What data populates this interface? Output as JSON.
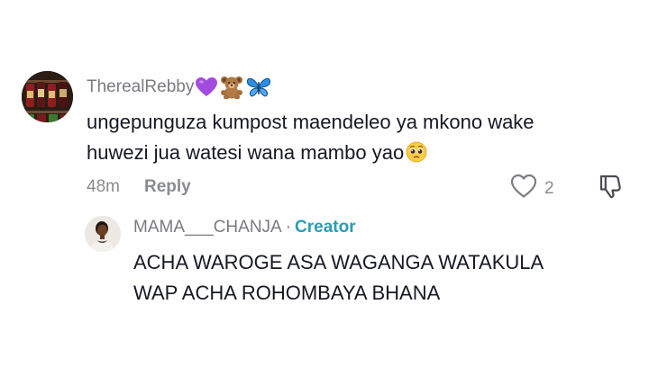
{
  "comment": {
    "username": "TherealRebby",
    "username_emojis": [
      "purple-heart-icon",
      "teddy-bear-icon",
      "butterfly-icon"
    ],
    "text_line_1": "ungepunguza kumpost maendeleo ya mkono wake",
    "text_line_2": "huwezi jua watesi wana mambo yao",
    "text_emoji": "pleading-face-icon",
    "time": "48m",
    "reply_label": "Reply",
    "like_count": "2"
  },
  "reply": {
    "username": "MAMA___CHANJA",
    "separator": "·",
    "badge": "Creator",
    "text_line_1": "ACHA WAROGE ASA WAGANGA WATAKULA",
    "text_line_2": "WAP ACHA ROHOMBAYA BHANA"
  },
  "colors": {
    "text": "#161823",
    "muted": "#8a8b91",
    "creator_badge": "#2b9cb5"
  }
}
